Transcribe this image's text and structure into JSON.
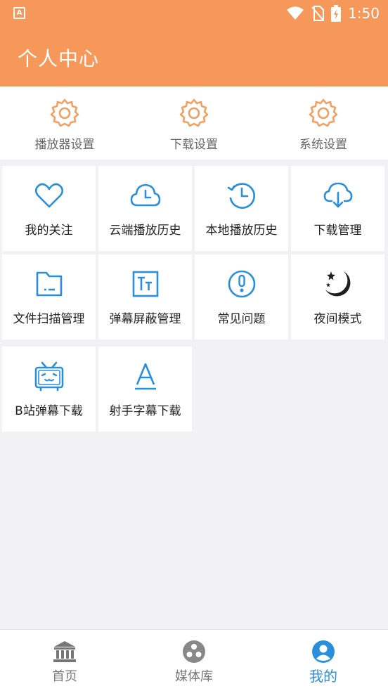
{
  "status_bar": {
    "time": "1:50"
  },
  "header": {
    "title": "个人中心"
  },
  "settings": [
    {
      "label": "播放器设置",
      "icon": "gear-icon"
    },
    {
      "label": "下载设置",
      "icon": "gear-icon"
    },
    {
      "label": "系统设置",
      "icon": "gear-icon"
    }
  ],
  "grid": [
    {
      "label": "我的关注",
      "icon": "heart-icon"
    },
    {
      "label": "云端播放历史",
      "icon": "cloud-clock-icon"
    },
    {
      "label": "本地播放历史",
      "icon": "history-clock-icon"
    },
    {
      "label": "下载管理",
      "icon": "cloud-download-icon"
    },
    {
      "label": "文件扫描管理",
      "icon": "folder-icon"
    },
    {
      "label": "弹幕屏蔽管理",
      "icon": "text-block-icon"
    },
    {
      "label": "常见问题",
      "icon": "exclamation-circle-icon"
    },
    {
      "label": "夜间模式",
      "icon": "moon-stars-icon"
    },
    {
      "label": "B站弹幕下载",
      "icon": "bilibili-tv-icon"
    },
    {
      "label": "射手字幕下载",
      "icon": "letter-a-icon"
    }
  ],
  "bottom_nav": [
    {
      "label": "首页",
      "icon": "bank-icon"
    },
    {
      "label": "媒体库",
      "icon": "media-icon"
    },
    {
      "label": "我的",
      "icon": "user-icon",
      "active": true
    }
  ],
  "colors": {
    "header": "#f6985a",
    "accent_blue": "#2a8fdb",
    "settings_icon": "#f0a060"
  }
}
